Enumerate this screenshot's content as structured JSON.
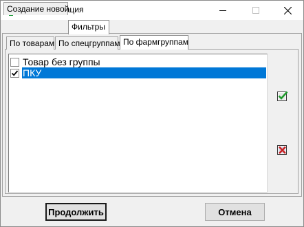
{
  "window": {
    "title": "Инвентаризация",
    "icon": "green-cross-icon"
  },
  "outer_tabs": [
    {
      "label": "Создание новой",
      "active": false
    },
    {
      "label": "Фильтры",
      "active": true
    }
  ],
  "inner_tabs": [
    {
      "label": "По товарам",
      "active": false
    },
    {
      "label": "По спецгруппам",
      "active": false
    },
    {
      "label": "По фармгруппам",
      "active": true
    }
  ],
  "list": {
    "items": [
      {
        "label": "Товар без группы",
        "checked": false,
        "selected": false
      },
      {
        "label": "ПКУ",
        "checked": true,
        "selected": true
      }
    ]
  },
  "side_buttons": {
    "check_all": "check-all-icon",
    "uncheck_all": "uncheck-all-icon"
  },
  "footer": {
    "continue_label": "Продолжить",
    "cancel_label": "Отмена"
  },
  "colors": {
    "selection": "#0078d7",
    "window_bg": "#f0f0f0"
  }
}
